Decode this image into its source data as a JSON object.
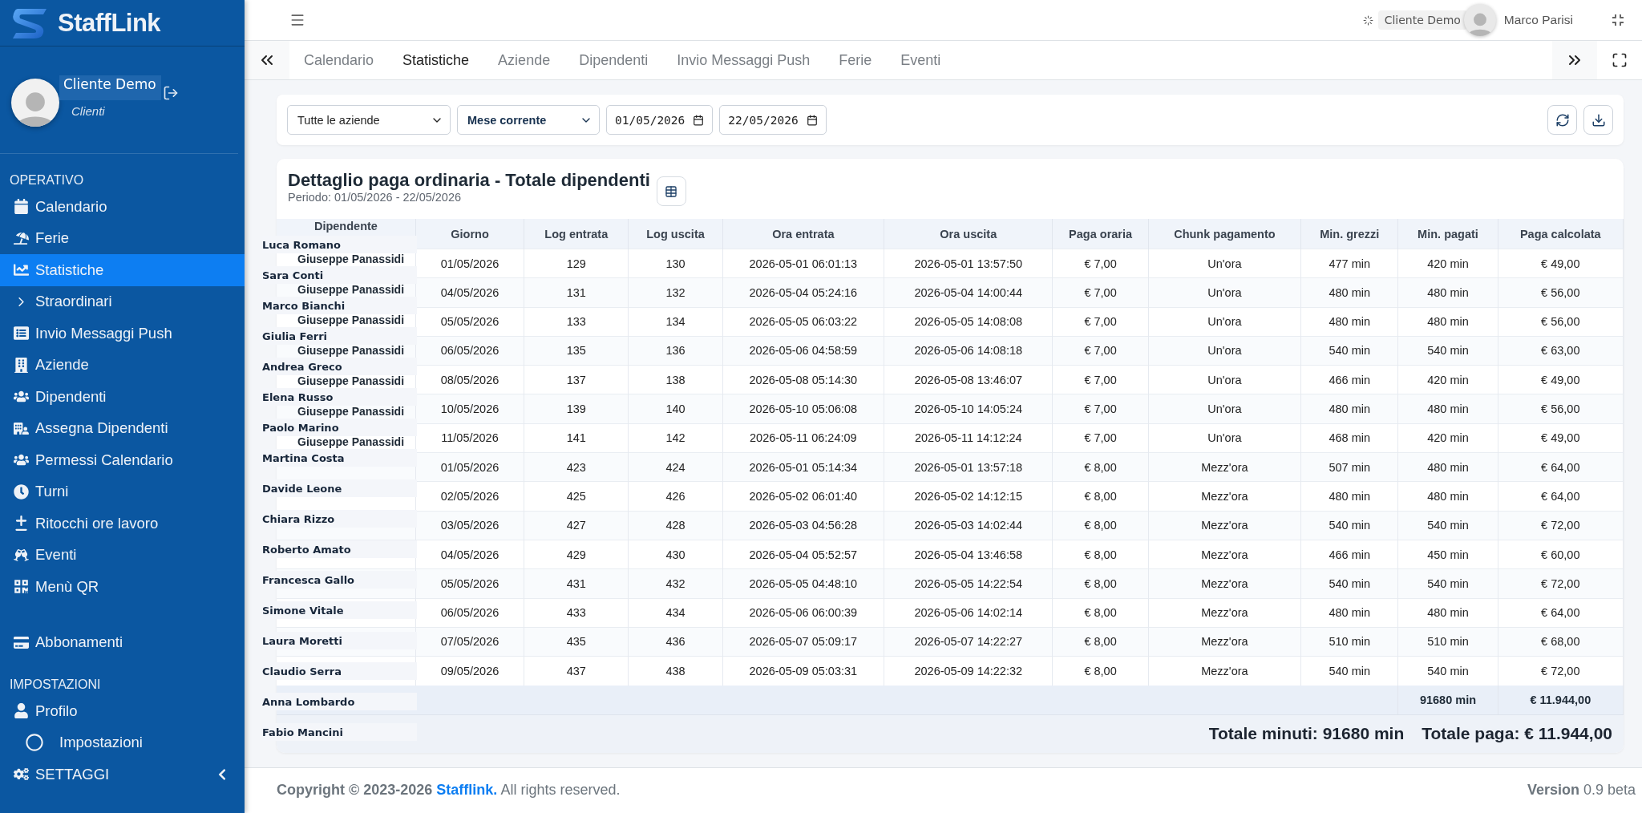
{
  "brand": {
    "name": "StaffLink"
  },
  "profile": {
    "name": "Cliente Demo",
    "role": "Clienti"
  },
  "sidebar": {
    "sections": [
      {
        "title": "OPERATIVO",
        "items": [
          {
            "label": "Calendario",
            "selected": false
          },
          {
            "label": "Ferie",
            "selected": false
          },
          {
            "label": "Statistiche",
            "selected": true
          },
          {
            "label": "Straordinari",
            "selected": false
          },
          {
            "label": "Invio Messaggi Push",
            "selected": false
          },
          {
            "label": "Aziende",
            "selected": false
          },
          {
            "label": "Dipendenti",
            "selected": false
          },
          {
            "label": "Assegna Dipendenti",
            "selected": false
          },
          {
            "label": "Permessi Calendario",
            "selected": false
          },
          {
            "label": "Turni",
            "selected": false
          },
          {
            "label": "Ritocchi ore lavoro",
            "selected": false
          },
          {
            "label": "Eventi",
            "selected": false
          },
          {
            "label": "Menù QR",
            "selected": false
          }
        ]
      },
      {
        "items": [
          {
            "label": "Abbonamenti",
            "selected": false
          }
        ]
      },
      {
        "title": "IMPOSTAZIONI",
        "items": [
          {
            "label": "Profilo",
            "selected": false
          },
          {
            "label": "Impostazioni",
            "selected": false,
            "kind": "sub"
          },
          {
            "label": "SETTAGGI",
            "selected": false,
            "kind": "group",
            "expanded": false
          }
        ]
      }
    ]
  },
  "topbar": {
    "client": "Cliente Demo",
    "user": "Marco Parisi"
  },
  "tabs": [
    {
      "label": "Calendario",
      "selected": false
    },
    {
      "label": "Statistiche",
      "selected": true
    },
    {
      "label": "Aziende",
      "selected": false
    },
    {
      "label": "Dipendenti",
      "selected": false
    },
    {
      "label": "Invio Messaggi Push",
      "selected": false
    },
    {
      "label": "Ferie",
      "selected": false
    },
    {
      "label": "Eventi",
      "selected": false
    }
  ],
  "filters": {
    "company": "Tutte le aziende",
    "period": "Mese corrente",
    "from": "01/05/2026",
    "to": "22/05/2026"
  },
  "report": {
    "title": "Dettaglio paga ordinaria - Totale dipendenti",
    "period": "Periodo: 01/05/2026 - 22/05/2026",
    "columns": [
      "Dipendente",
      "Giorno",
      "Log entrata",
      "Log uscita",
      "Ora entrata",
      "Ora uscita",
      "Paga oraria",
      "Chunk pagamento",
      "Min. grezzi",
      "Min. pagati",
      "Paga calcolata"
    ],
    "rows": [
      {
        "cells": [
          "Giuseppe Panassidi",
          "01/05/2026",
          "129",
          "130",
          "2026-05-01 06:01:13",
          "2026-05-01 13:57:50",
          "€ 7,00",
          "Un'ora",
          "477 min",
          "420 min",
          "€ 49,00"
        ]
      },
      {
        "cells": [
          "Giuseppe Panassidi",
          "04/05/2026",
          "131",
          "132",
          "2026-05-04 05:24:16",
          "2026-05-04 14:00:44",
          "€ 7,00",
          "Un'ora",
          "480 min",
          "480 min",
          "€ 56,00"
        ]
      },
      {
        "cells": [
          "Giuseppe Panassidi",
          "05/05/2026",
          "133",
          "134",
          "2026-05-05 06:03:22",
          "2026-05-05 14:08:08",
          "€ 7,00",
          "Un'ora",
          "480 min",
          "480 min",
          "€ 56,00"
        ]
      },
      {
        "cells": [
          "Giuseppe Panassidi",
          "06/05/2026",
          "135",
          "136",
          "2026-05-06 04:58:59",
          "2026-05-06 14:08:18",
          "€ 7,00",
          "Un'ora",
          "540 min",
          "540 min",
          "€ 63,00"
        ]
      },
      {
        "cells": [
          "Giuseppe Panassidi",
          "08/05/2026",
          "137",
          "138",
          "2026-05-08 05:14:30",
          "2026-05-08 13:46:07",
          "€ 7,00",
          "Un'ora",
          "466 min",
          "420 min",
          "€ 49,00"
        ]
      },
      {
        "cells": [
          "Giuseppe Panassidi",
          "10/05/2026",
          "139",
          "140",
          "2026-05-10 05:06:08",
          "2026-05-10 14:05:24",
          "€ 7,00",
          "Un'ora",
          "480 min",
          "480 min",
          "€ 56,00"
        ]
      },
      {
        "cells": [
          "Giuseppe Panassidi",
          "11/05/2026",
          "141",
          "142",
          "2026-05-11 06:24:09",
          "2026-05-11 14:12:24",
          "€ 7,00",
          "Un'ora",
          "468 min",
          "420 min",
          "€ 49,00"
        ]
      },
      {
        "cells": [
          "",
          "01/05/2026",
          "423",
          "424",
          "2026-05-01 05:14:34",
          "2026-05-01 13:57:18",
          "€ 8,00",
          "Mezz'ora",
          "507 min",
          "480 min",
          "€ 64,00"
        ]
      },
      {
        "cells": [
          "",
          "02/05/2026",
          "425",
          "426",
          "2026-05-02 06:01:40",
          "2026-05-02 14:12:15",
          "€ 8,00",
          "Mezz'ora",
          "480 min",
          "480 min",
          "€ 64,00"
        ]
      },
      {
        "cells": [
          "",
          "03/05/2026",
          "427",
          "428",
          "2026-05-03 04:56:28",
          "2026-05-03 14:02:44",
          "€ 8,00",
          "Mezz'ora",
          "540 min",
          "540 min",
          "€ 72,00"
        ]
      },
      {
        "cells": [
          "",
          "04/05/2026",
          "429",
          "430",
          "2026-05-04 05:52:57",
          "2026-05-04 13:46:58",
          "€ 8,00",
          "Mezz'ora",
          "466 min",
          "450 min",
          "€ 60,00"
        ]
      },
      {
        "cells": [
          "",
          "05/05/2026",
          "431",
          "432",
          "2026-05-05 04:48:10",
          "2026-05-05 14:22:54",
          "€ 8,00",
          "Mezz'ora",
          "540 min",
          "540 min",
          "€ 72,00"
        ]
      },
      {
        "cells": [
          "",
          "06/05/2026",
          "433",
          "434",
          "2026-05-06 06:00:39",
          "2026-05-06 14:02:14",
          "€ 8,00",
          "Mezz'ora",
          "480 min",
          "480 min",
          "€ 64,00"
        ]
      },
      {
        "cells": [
          "",
          "07/05/2026",
          "435",
          "436",
          "2026-05-07 05:09:17",
          "2026-05-07 14:22:27",
          "€ 8,00",
          "Mezz'ora",
          "510 min",
          "510 min",
          "€ 68,00"
        ]
      },
      {
        "cells": [
          "",
          "09/05/2026",
          "437",
          "438",
          "2026-05-09 05:03:31",
          "2026-05-09 14:22:32",
          "€ 8,00",
          "Mezz'ora",
          "540 min",
          "540 min",
          "€ 72,00"
        ]
      }
    ],
    "totals": {
      "minutes": "91680 min",
      "pay": "€ 11.944,00"
    },
    "summary": [
      "Totale minuti: 91680 min",
      "Totale paga: € 11.944,00"
    ]
  },
  "overlay_names": [
    "Luca Romano",
    "Sara Conti",
    "Marco Bianchi",
    "Giulia Ferri",
    "Andrea Greco",
    "Elena Russo",
    "Paolo Marino",
    "Martina Costa",
    "Davide Leone",
    "Chiara Rizzo",
    "Roberto Amato",
    "Francesca Gallo",
    "Simone Vitale",
    "Laura Moretti",
    "Claudio Serra",
    "Anna Lombardo",
    "Fabio Mancini"
  ],
  "footer": {
    "copyright": "Copyright © 2023-2026",
    "link": "Stafflink.",
    "rights": "All rights reserved.",
    "version": "**Version** 0.9 beta"
  }
}
